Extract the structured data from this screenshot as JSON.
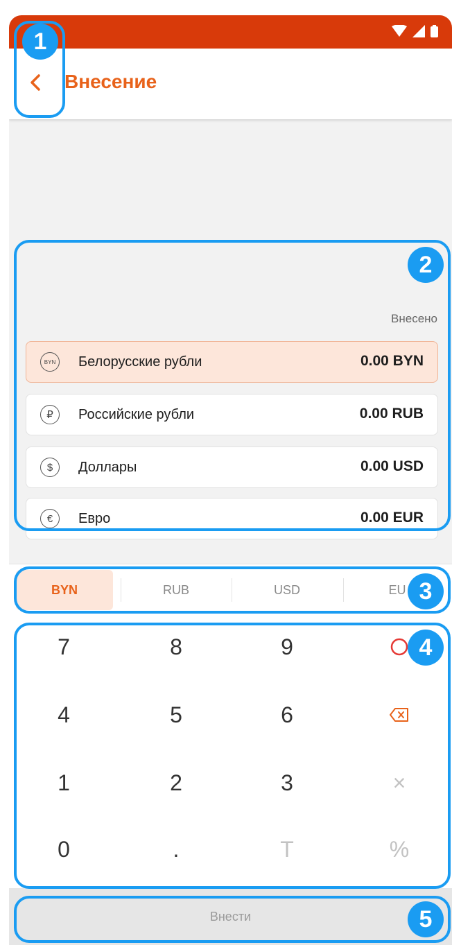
{
  "colors": {
    "accent": "#e8621a",
    "statusbar": "#d83a0a",
    "callout": "#1a9cf2"
  },
  "header": {
    "title": "Внесение",
    "back_icon": "chevron-left-icon"
  },
  "summary": {
    "label": "Внесено",
    "rows": [
      {
        "icon": "BYN",
        "name": "Белорусские рубли",
        "amount": "0.00 BYN"
      },
      {
        "icon": "₽",
        "name": "Российские рубли",
        "amount": "0.00 RUB"
      },
      {
        "icon": "$",
        "name": "Доллары",
        "amount": "0.00 USD"
      },
      {
        "icon": "€",
        "name": "Евро",
        "amount": "0.00 EUR"
      }
    ]
  },
  "tabs": [
    "BYN",
    "RUB",
    "USD",
    "EU"
  ],
  "keypad": {
    "row1": [
      "7",
      "8",
      "9"
    ],
    "row2": [
      "4",
      "5",
      "6"
    ],
    "row3": [
      "1",
      "2",
      "3",
      "×"
    ],
    "row4": [
      "0",
      ".",
      "T",
      "%"
    ]
  },
  "submit_label": "Внести",
  "callouts": [
    "1",
    "2",
    "3",
    "4",
    "5"
  ]
}
